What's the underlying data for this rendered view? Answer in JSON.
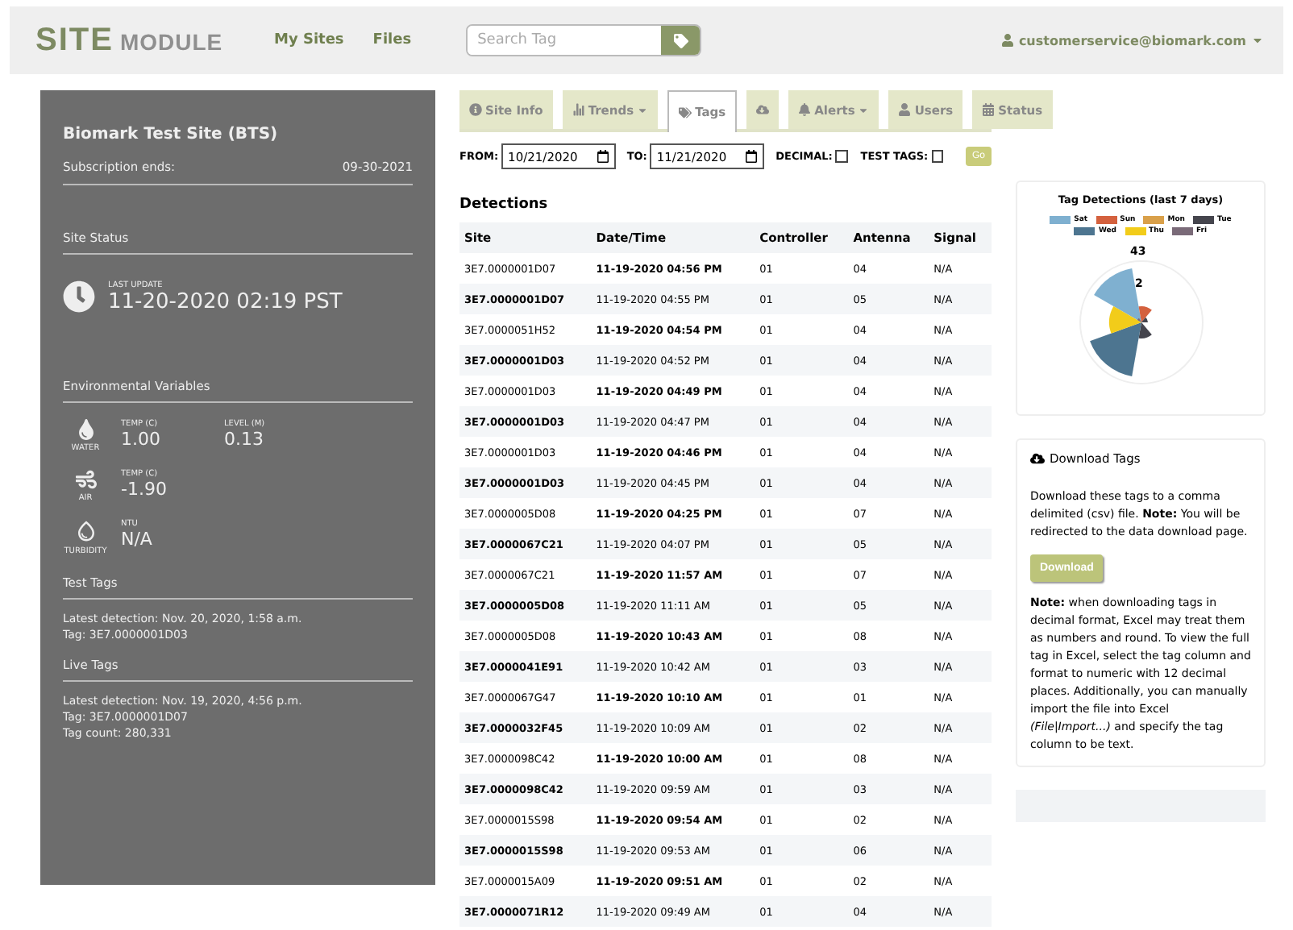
{
  "header": {
    "logo": {
      "primary": "SITE",
      "secondary": "MODULE"
    },
    "nav": [
      "My Sites",
      "Files"
    ],
    "search": {
      "placeholder": "Search Tag"
    },
    "user": "customerservice@biomark.com"
  },
  "site_panel": {
    "title": "Biomark Test Site (BTS)",
    "subscription": {
      "label": "Subscription ends:",
      "value": "09-30-2021"
    },
    "status_heading": "Site Status",
    "last_update": {
      "label": "LAST UPDATE",
      "value": "11-20-2020 02:19 PST"
    },
    "env_heading": "Environmental Variables",
    "env": [
      {
        "kind": "water",
        "label": "WATER",
        "readings": [
          {
            "label": "TEMP (C)",
            "value": "1.00"
          },
          {
            "label": "LEVEL (M)",
            "value": "0.13"
          }
        ]
      },
      {
        "kind": "air",
        "label": "AIR",
        "readings": [
          {
            "label": "TEMP (C)",
            "value": "-1.90"
          }
        ]
      },
      {
        "kind": "turbidity",
        "label": "TURBIDITY",
        "readings": [
          {
            "label": "NTU",
            "value": "N/A"
          }
        ]
      }
    ],
    "test_tags": {
      "heading": "Test Tags",
      "lines": [
        "Latest detection: Nov. 20, 2020, 1:58 a.m.",
        "Tag: 3E7.0000001D03"
      ]
    },
    "live_tags": {
      "heading": "Live Tags",
      "lines": [
        "Latest detection: Nov. 19, 2020, 4:56 p.m.",
        "Tag: 3E7.0000001D07",
        "Tag count: 280,331"
      ]
    }
  },
  "tabs": [
    {
      "label": "Site Info",
      "dropdown": false,
      "selected": false
    },
    {
      "label": "Trends",
      "dropdown": true,
      "selected": false
    },
    {
      "label": "Tags",
      "dropdown": false,
      "selected": true
    },
    {
      "dropdown": false,
      "selected": false
    },
    {
      "label": "Alerts",
      "dropdown": true,
      "selected": false
    },
    {
      "label": "Users",
      "dropdown": false,
      "selected": false
    },
    {
      "label": "Status",
      "dropdown": false,
      "selected": false
    }
  ],
  "filters": {
    "from": {
      "label": "FROM:",
      "value": "10/21/2020"
    },
    "to": {
      "label": "TO:",
      "value": "11/21/2020"
    },
    "decimal": {
      "label": "DECIMAL:",
      "checked": false
    },
    "test_tags": {
      "label": "TEST TAGS:",
      "checked": false
    },
    "go": "Go"
  },
  "detections": {
    "title": "Detections",
    "columns": [
      "Site",
      "Date/Time",
      "Controller",
      "Antenna",
      "Signal"
    ],
    "rows": [
      [
        "3E7.0000001D07",
        "11-19-2020 04:56 PM",
        "01",
        "04",
        "N/A"
      ],
      [
        "3E7.0000001D07",
        "11-19-2020 04:55 PM",
        "01",
        "05",
        "N/A"
      ],
      [
        "3E7.0000051H52",
        "11-19-2020 04:54 PM",
        "01",
        "04",
        "N/A"
      ],
      [
        "3E7.0000001D03",
        "11-19-2020 04:52 PM",
        "01",
        "04",
        "N/A"
      ],
      [
        "3E7.0000001D03",
        "11-19-2020 04:49 PM",
        "01",
        "04",
        "N/A"
      ],
      [
        "3E7.0000001D03",
        "11-19-2020 04:47 PM",
        "01",
        "04",
        "N/A"
      ],
      [
        "3E7.0000001D03",
        "11-19-2020 04:46 PM",
        "01",
        "04",
        "N/A"
      ],
      [
        "3E7.0000001D03",
        "11-19-2020 04:45 PM",
        "01",
        "04",
        "N/A"
      ],
      [
        "3E7.0000005D08",
        "11-19-2020 04:25 PM",
        "01",
        "07",
        "N/A"
      ],
      [
        "3E7.0000067C21",
        "11-19-2020 04:07 PM",
        "01",
        "05",
        "N/A"
      ],
      [
        "3E7.0000067C21",
        "11-19-2020 11:57 AM",
        "01",
        "07",
        "N/A"
      ],
      [
        "3E7.0000005D08",
        "11-19-2020 11:11 AM",
        "01",
        "05",
        "N/A"
      ],
      [
        "3E7.0000005D08",
        "11-19-2020 10:43 AM",
        "01",
        "08",
        "N/A"
      ],
      [
        "3E7.0000041E91",
        "11-19-2020 10:42 AM",
        "01",
        "03",
        "N/A"
      ],
      [
        "3E7.0000067G47",
        "11-19-2020 10:10 AM",
        "01",
        "01",
        "N/A"
      ],
      [
        "3E7.0000032F45",
        "11-19-2020 10:09 AM",
        "01",
        "02",
        "N/A"
      ],
      [
        "3E7.0000098C42",
        "11-19-2020 10:00 AM",
        "01",
        "08",
        "N/A"
      ],
      [
        "3E7.0000098C42",
        "11-19-2020 09:59 AM",
        "01",
        "03",
        "N/A"
      ],
      [
        "3E7.0000015S98",
        "11-19-2020 09:54 AM",
        "01",
        "02",
        "N/A"
      ],
      [
        "3E7.0000015S98",
        "11-19-2020 09:53 AM",
        "01",
        "06",
        "N/A"
      ],
      [
        "3E7.0000015A09",
        "11-19-2020 09:51 AM",
        "01",
        "02",
        "N/A"
      ],
      [
        "3E7.0000071R12",
        "11-19-2020 09:49 AM",
        "01",
        "04",
        "N/A"
      ]
    ]
  },
  "chart_card": {
    "title": "Tag Detections (last 7 days)",
    "legend": [
      {
        "label": "Sat",
        "color": "#7fb0d0"
      },
      {
        "label": "Sun",
        "color": "#d4613e"
      },
      {
        "label": "Mon",
        "color": "#d9a04a"
      },
      {
        "label": "Tue",
        "color": "#45454d"
      },
      {
        "label": "Wed",
        "color": "#4d7590"
      },
      {
        "label": "Thu",
        "color": "#f2cc1a"
      },
      {
        "label": "Fri",
        "color": "#7a6a78"
      }
    ],
    "scale_labels": [
      "43",
      "2"
    ]
  },
  "download_card": {
    "title": "Download Tags",
    "intro": "Download these tags to a comma delimited (csv) file. **Note:** You will be redirected to the data download page.",
    "button": "Download",
    "note": "**Note:** when downloading tags in decimal format, Excel may treat them as numbers and round. To view the full tag in Excel, select the tag column and format to numeric with 12 decimal places. Additionally, you can manually import the file into Excel *(File|Import...)* and specify the tag column to be text."
  }
}
